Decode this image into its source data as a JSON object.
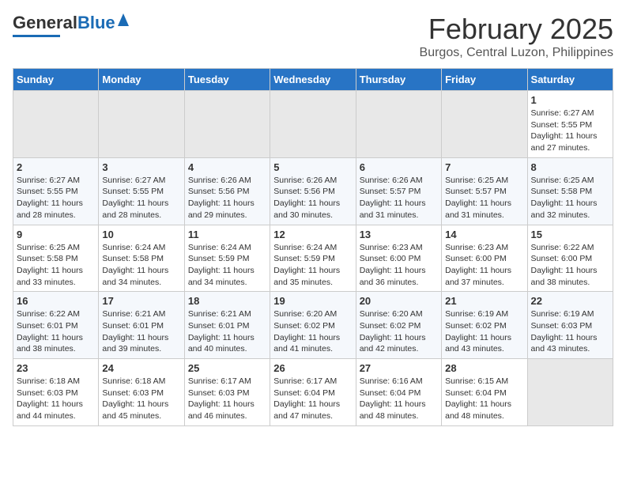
{
  "header": {
    "logo_general": "General",
    "logo_blue": "Blue",
    "title": "February 2025",
    "subtitle": "Burgos, Central Luzon, Philippines"
  },
  "weekdays": [
    "Sunday",
    "Monday",
    "Tuesday",
    "Wednesday",
    "Thursday",
    "Friday",
    "Saturday"
  ],
  "weeks": [
    [
      {
        "day": "",
        "info": ""
      },
      {
        "day": "",
        "info": ""
      },
      {
        "day": "",
        "info": ""
      },
      {
        "day": "",
        "info": ""
      },
      {
        "day": "",
        "info": ""
      },
      {
        "day": "",
        "info": ""
      },
      {
        "day": "1",
        "info": "Sunrise: 6:27 AM\nSunset: 5:55 PM\nDaylight: 11 hours and 27 minutes."
      }
    ],
    [
      {
        "day": "2",
        "info": "Sunrise: 6:27 AM\nSunset: 5:55 PM\nDaylight: 11 hours and 28 minutes."
      },
      {
        "day": "3",
        "info": "Sunrise: 6:27 AM\nSunset: 5:55 PM\nDaylight: 11 hours and 28 minutes."
      },
      {
        "day": "4",
        "info": "Sunrise: 6:26 AM\nSunset: 5:56 PM\nDaylight: 11 hours and 29 minutes."
      },
      {
        "day": "5",
        "info": "Sunrise: 6:26 AM\nSunset: 5:56 PM\nDaylight: 11 hours and 30 minutes."
      },
      {
        "day": "6",
        "info": "Sunrise: 6:26 AM\nSunset: 5:57 PM\nDaylight: 11 hours and 31 minutes."
      },
      {
        "day": "7",
        "info": "Sunrise: 6:25 AM\nSunset: 5:57 PM\nDaylight: 11 hours and 31 minutes."
      },
      {
        "day": "8",
        "info": "Sunrise: 6:25 AM\nSunset: 5:58 PM\nDaylight: 11 hours and 32 minutes."
      }
    ],
    [
      {
        "day": "9",
        "info": "Sunrise: 6:25 AM\nSunset: 5:58 PM\nDaylight: 11 hours and 33 minutes."
      },
      {
        "day": "10",
        "info": "Sunrise: 6:24 AM\nSunset: 5:58 PM\nDaylight: 11 hours and 34 minutes."
      },
      {
        "day": "11",
        "info": "Sunrise: 6:24 AM\nSunset: 5:59 PM\nDaylight: 11 hours and 34 minutes."
      },
      {
        "day": "12",
        "info": "Sunrise: 6:24 AM\nSunset: 5:59 PM\nDaylight: 11 hours and 35 minutes."
      },
      {
        "day": "13",
        "info": "Sunrise: 6:23 AM\nSunset: 6:00 PM\nDaylight: 11 hours and 36 minutes."
      },
      {
        "day": "14",
        "info": "Sunrise: 6:23 AM\nSunset: 6:00 PM\nDaylight: 11 hours and 37 minutes."
      },
      {
        "day": "15",
        "info": "Sunrise: 6:22 AM\nSunset: 6:00 PM\nDaylight: 11 hours and 38 minutes."
      }
    ],
    [
      {
        "day": "16",
        "info": "Sunrise: 6:22 AM\nSunset: 6:01 PM\nDaylight: 11 hours and 38 minutes."
      },
      {
        "day": "17",
        "info": "Sunrise: 6:21 AM\nSunset: 6:01 PM\nDaylight: 11 hours and 39 minutes."
      },
      {
        "day": "18",
        "info": "Sunrise: 6:21 AM\nSunset: 6:01 PM\nDaylight: 11 hours and 40 minutes."
      },
      {
        "day": "19",
        "info": "Sunrise: 6:20 AM\nSunset: 6:02 PM\nDaylight: 11 hours and 41 minutes."
      },
      {
        "day": "20",
        "info": "Sunrise: 6:20 AM\nSunset: 6:02 PM\nDaylight: 11 hours and 42 minutes."
      },
      {
        "day": "21",
        "info": "Sunrise: 6:19 AM\nSunset: 6:02 PM\nDaylight: 11 hours and 43 minutes."
      },
      {
        "day": "22",
        "info": "Sunrise: 6:19 AM\nSunset: 6:03 PM\nDaylight: 11 hours and 43 minutes."
      }
    ],
    [
      {
        "day": "23",
        "info": "Sunrise: 6:18 AM\nSunset: 6:03 PM\nDaylight: 11 hours and 44 minutes."
      },
      {
        "day": "24",
        "info": "Sunrise: 6:18 AM\nSunset: 6:03 PM\nDaylight: 11 hours and 45 minutes."
      },
      {
        "day": "25",
        "info": "Sunrise: 6:17 AM\nSunset: 6:03 PM\nDaylight: 11 hours and 46 minutes."
      },
      {
        "day": "26",
        "info": "Sunrise: 6:17 AM\nSunset: 6:04 PM\nDaylight: 11 hours and 47 minutes."
      },
      {
        "day": "27",
        "info": "Sunrise: 6:16 AM\nSunset: 6:04 PM\nDaylight: 11 hours and 48 minutes."
      },
      {
        "day": "28",
        "info": "Sunrise: 6:15 AM\nSunset: 6:04 PM\nDaylight: 11 hours and 48 minutes."
      },
      {
        "day": "",
        "info": ""
      }
    ]
  ]
}
